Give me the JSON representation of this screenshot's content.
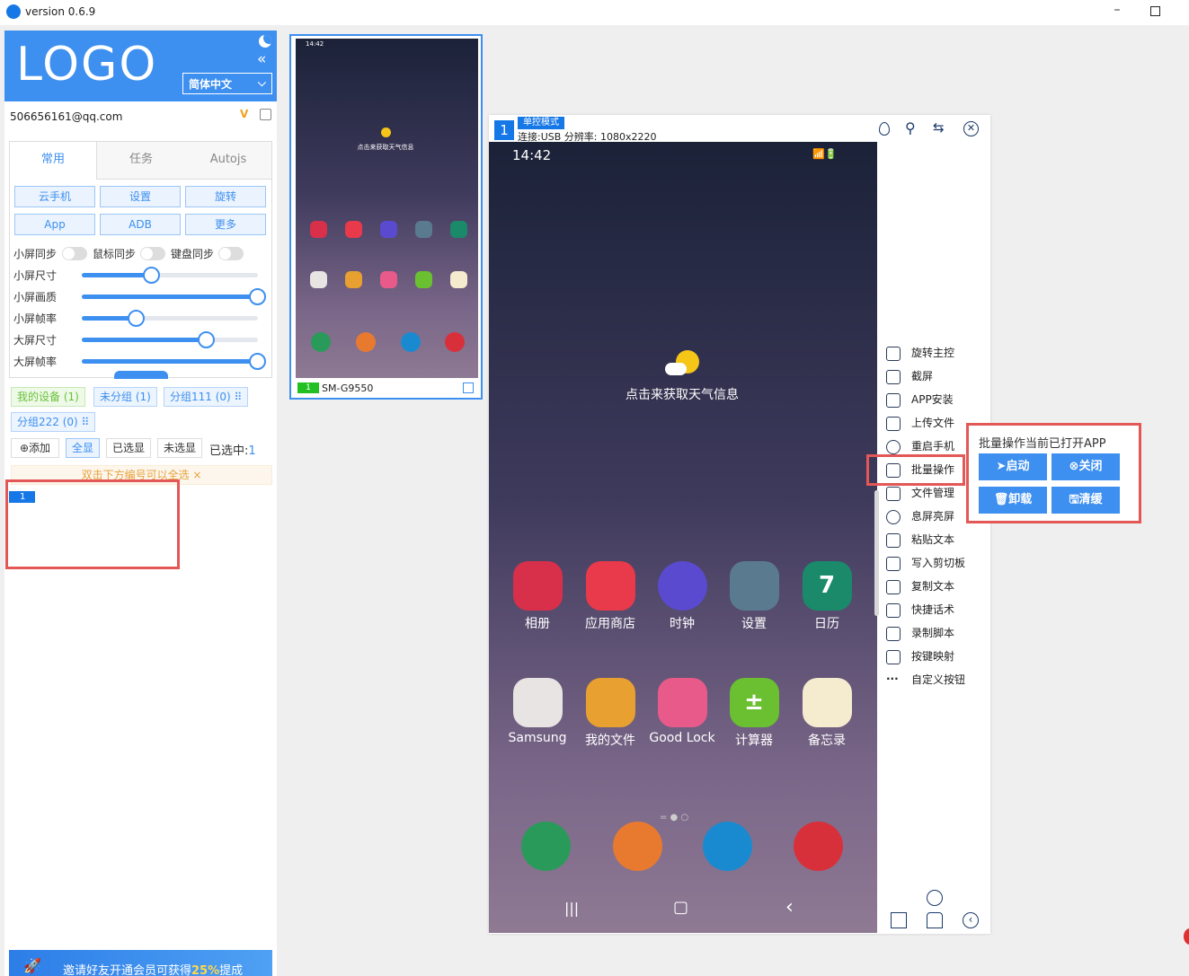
{
  "window": {
    "title": "version 0.6.9",
    "minimize": "–"
  },
  "header": {
    "logo": "LOGO",
    "language": "简体中文",
    "lang_chevron": "⌵",
    "collapse": "«"
  },
  "account": {
    "email": "506656161@qq.com",
    "vip": "V"
  },
  "tabs": [
    {
      "label": "常用"
    },
    {
      "label": "任务"
    },
    {
      "label": "Autojs"
    }
  ],
  "actions": [
    {
      "label": "云手机"
    },
    {
      "label": "设置"
    },
    {
      "label": "旋转"
    },
    {
      "label": "App"
    },
    {
      "label": "ADB"
    },
    {
      "label": "更多"
    }
  ],
  "sync": [
    {
      "label": "小屏同步"
    },
    {
      "label": "鼠标同步"
    },
    {
      "label": "键盘同步"
    }
  ],
  "sliders": [
    {
      "label": "小屏尺寸",
      "value": 0.4
    },
    {
      "label": "小屏画质",
      "value": 1.0
    },
    {
      "label": "小屏帧率",
      "value": 0.31
    },
    {
      "label": "大屏尺寸",
      "value": 0.71
    },
    {
      "label": "大屏帧率",
      "value": 1.0
    }
  ],
  "groups": [
    {
      "label": "我的设备 (1)"
    },
    {
      "label": "未分组 (1)"
    },
    {
      "label": "分组111 (0) ⠿"
    },
    {
      "label": "分组222 (0) ⠿"
    }
  ],
  "select_actions": {
    "add": "⊕添加",
    "all": "全显",
    "selected": "已选显",
    "unselected": "未选显",
    "count_label": "已选中:",
    "count": "1"
  },
  "hint": "双击下方编号可以全选 ×",
  "device_list": [
    {
      "number": "1"
    }
  ],
  "invite": {
    "prefix": "邀请好友开通会员可获得",
    "percent": "25%",
    "suffix": "提成"
  },
  "preview": {
    "time": "14:42",
    "weather": "点击来获取天气信息",
    "model": "SM-G9550",
    "index": "1"
  },
  "main_window": {
    "number": "1",
    "mode": "单控模式",
    "connection": "连接:USB 分辨率: 1080x2220"
  },
  "phone": {
    "time": "14:42",
    "weather": "点击来获取天气信息",
    "apps_row1": [
      {
        "label": "相册",
        "color": "#d8304a"
      },
      {
        "label": "应用商店",
        "color": "#e83a4a"
      },
      {
        "label": "时钟",
        "color": "#5a4ad0"
      },
      {
        "label": "设置",
        "color": "#5a7a90"
      },
      {
        "label": "日历",
        "color": "#1a8a6a",
        "glyph": "7"
      }
    ],
    "apps_row2": [
      {
        "label": "Samsung",
        "color": "#e8e4e4"
      },
      {
        "label": "我的文件",
        "color": "#e8a030"
      },
      {
        "label": "Good Lock",
        "color": "#e85a8a"
      },
      {
        "label": "计算器",
        "color": "#6ac030",
        "glyph": "±"
      },
      {
        "label": "备忘录",
        "color": "#f5ecd0"
      }
    ],
    "dock": [
      {
        "name": "phone",
        "color": "#2a9a5a"
      },
      {
        "name": "contacts",
        "color": "#e87a30"
      },
      {
        "name": "messages",
        "color": "#1a8ad0"
      },
      {
        "name": "camera",
        "color": "#d8303a"
      }
    ],
    "nav": {
      "recent": "|||",
      "home": "▢",
      "back": "‹"
    }
  },
  "side_tools": [
    {
      "label": "旋转主控",
      "icon": "rotate-icon"
    },
    {
      "label": "截屏",
      "icon": "screenshot-icon"
    },
    {
      "label": "APP安装",
      "icon": "android-icon"
    },
    {
      "label": "上传文件",
      "icon": "upload-icon"
    },
    {
      "label": "重启手机",
      "icon": "power-icon"
    },
    {
      "label": "批量操作",
      "icon": "cube-icon"
    },
    {
      "label": "文件管理",
      "icon": "folder-icon"
    },
    {
      "label": "息屏亮屏",
      "icon": "sun-icon"
    },
    {
      "label": "粘贴文本",
      "icon": "paste-icon"
    },
    {
      "label": "写入剪切板",
      "icon": "clipboard-icon"
    },
    {
      "label": "复制文本",
      "icon": "copy-icon"
    },
    {
      "label": "快捷话术",
      "icon": "chat-icon"
    },
    {
      "label": "录制脚本",
      "icon": "code-icon"
    },
    {
      "label": "按键映射",
      "icon": "gamepad-icon"
    },
    {
      "label": "自定义按钮",
      "icon": "more-icon"
    }
  ],
  "batch": {
    "title": "批量操作当前已打开APP",
    "start": "➤启动",
    "close": "⊗关闭",
    "uninstall": "🗑卸载",
    "clear": "🖫清缓"
  },
  "colors": {
    "accent": "#3d8ff0",
    "badge": "#1677e6",
    "highlight": "#e35757",
    "green": "#67c23a"
  }
}
